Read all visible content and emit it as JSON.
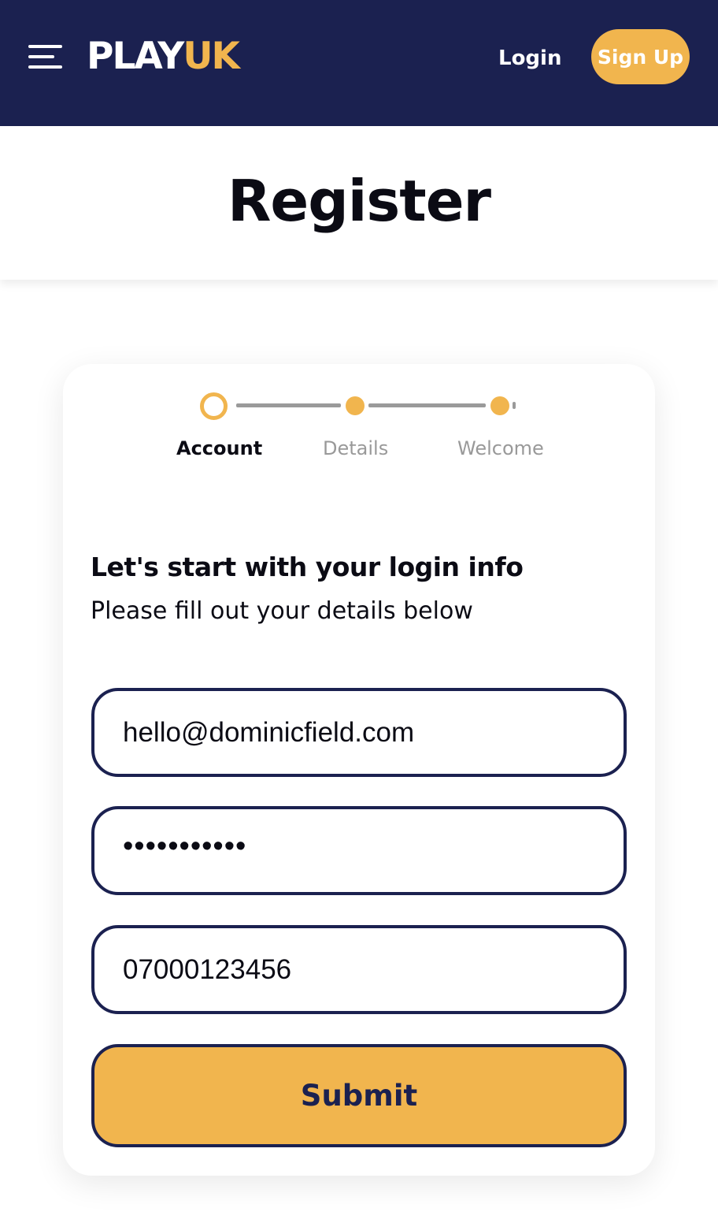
{
  "header": {
    "menu_icon": "hamburger-menu-icon",
    "logo_part1": "PLAY",
    "logo_part2": "UK",
    "login_label": "Login",
    "signup_label": "Sign Up"
  },
  "page": {
    "title": "Register"
  },
  "stepper": {
    "steps": [
      {
        "label": "Account",
        "state": "current"
      },
      {
        "label": "Details",
        "state": "upcoming"
      },
      {
        "label": "Welcome",
        "state": "upcoming"
      }
    ]
  },
  "form": {
    "heading": "Let's start with your login info",
    "subheading": "Please fill out your details below",
    "email_value": "hello@dominicfield.com",
    "password_mask": "•••••••••••",
    "phone_value": "07000123456",
    "submit_label": "Submit"
  },
  "colors": {
    "navy": "#1b2150",
    "accent": "#f1b54e",
    "text": "#0b0b14",
    "muted": "#999999"
  }
}
